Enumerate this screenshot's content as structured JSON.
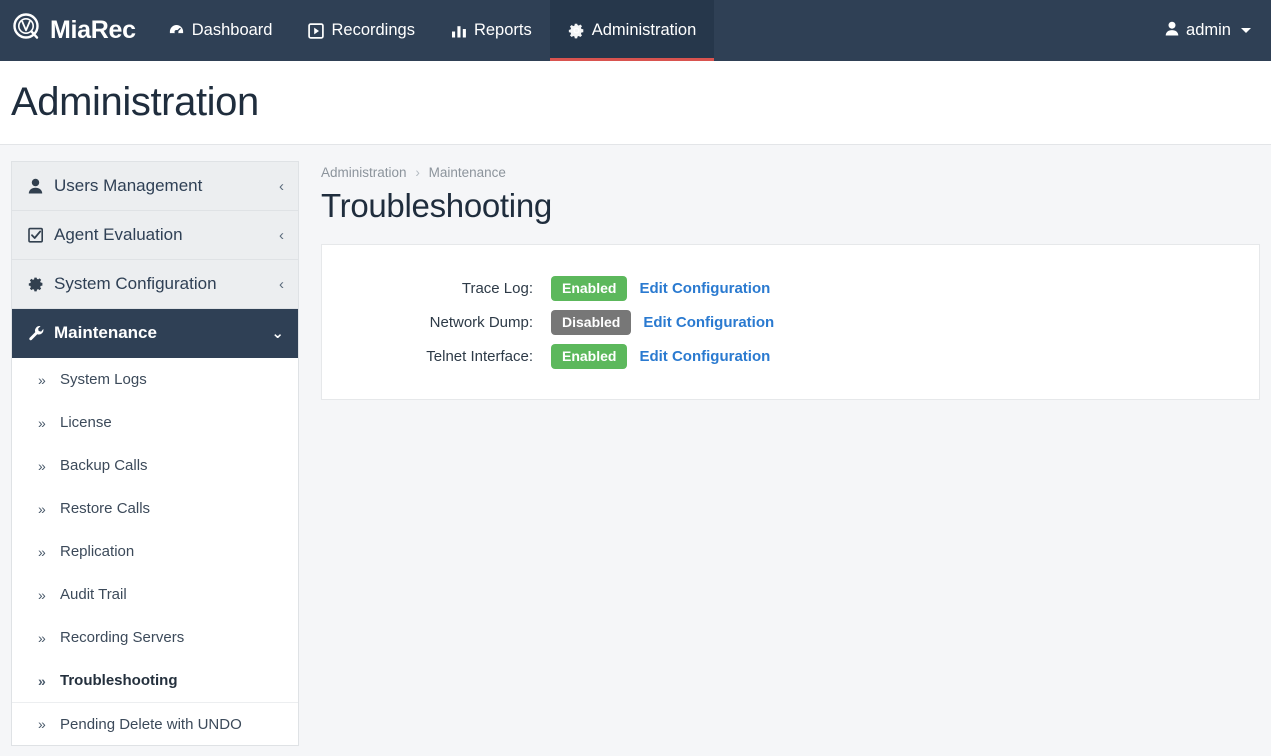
{
  "navbar": {
    "brand": "MiaRec",
    "brand_logo_icon": "miarec-circle-logo-icon",
    "items": [
      {
        "label": "Dashboard",
        "icon": "tachometer-icon",
        "active": false
      },
      {
        "label": "Recordings",
        "icon": "play-square-icon",
        "active": false
      },
      {
        "label": "Reports",
        "icon": "bar-chart-icon",
        "active": false
      },
      {
        "label": "Administration",
        "icon": "gear-icon",
        "active": true
      }
    ],
    "user": {
      "label": "admin",
      "icon": "user-icon",
      "caret_icon": "caret-down-icon"
    }
  },
  "page": {
    "title": "Administration"
  },
  "sidebar": {
    "groups": [
      {
        "label": "Users Management",
        "icon": "user-icon",
        "chevron": "‹",
        "active": false
      },
      {
        "label": "Agent Evaluation",
        "icon": "check-square-icon",
        "chevron": "‹",
        "active": false
      },
      {
        "label": "System Configuration",
        "icon": "gear-icon",
        "chevron": "‹",
        "active": false
      },
      {
        "label": "Maintenance",
        "icon": "wrench-icon",
        "chevron": "⌄",
        "active": true
      }
    ],
    "sub_items": [
      {
        "label": "System Logs",
        "bullet": "»",
        "current": false
      },
      {
        "label": "License",
        "bullet": "»",
        "current": false
      },
      {
        "label": "Backup Calls",
        "bullet": "»",
        "current": false
      },
      {
        "label": "Restore Calls",
        "bullet": "»",
        "current": false
      },
      {
        "label": "Replication",
        "bullet": "»",
        "current": false
      },
      {
        "label": "Audit Trail",
        "bullet": "»",
        "current": false
      },
      {
        "label": "Recording Servers",
        "bullet": "»",
        "current": false
      },
      {
        "label": "Troubleshooting",
        "bullet": "»",
        "current": true
      },
      {
        "label": "Pending Delete with UNDO",
        "bullet": "»",
        "current": false,
        "divider_above": true
      }
    ]
  },
  "main": {
    "breadcrumb": [
      {
        "label": "Administration",
        "link": true
      },
      {
        "label": "Maintenance",
        "link": true
      }
    ],
    "breadcrumb_separator": "›",
    "heading": "Troubleshooting",
    "settings": [
      {
        "label": "Trace Log:",
        "status": "Enabled",
        "status_state": "enabled",
        "action": "Edit Configuration"
      },
      {
        "label": "Network Dump:",
        "status": "Disabled",
        "status_state": "disabled",
        "action": "Edit Configuration"
      },
      {
        "label": "Telnet Interface:",
        "status": "Enabled",
        "status_state": "enabled",
        "action": "Edit Configuration"
      }
    ]
  },
  "colors": {
    "navbar_bg": "#2f4055",
    "navbar_active_bg": "#26374b",
    "active_tab_underline": "#d9534f",
    "sidebar_group_bg": "#eceef0",
    "sidebar_active_bg": "#2f4055",
    "badge_enabled": "#5cb85c",
    "badge_disabled": "#777777",
    "link_blue": "#2a7ad0",
    "page_bg": "#f5f6f8",
    "heading_text": "#1f2d3d"
  }
}
